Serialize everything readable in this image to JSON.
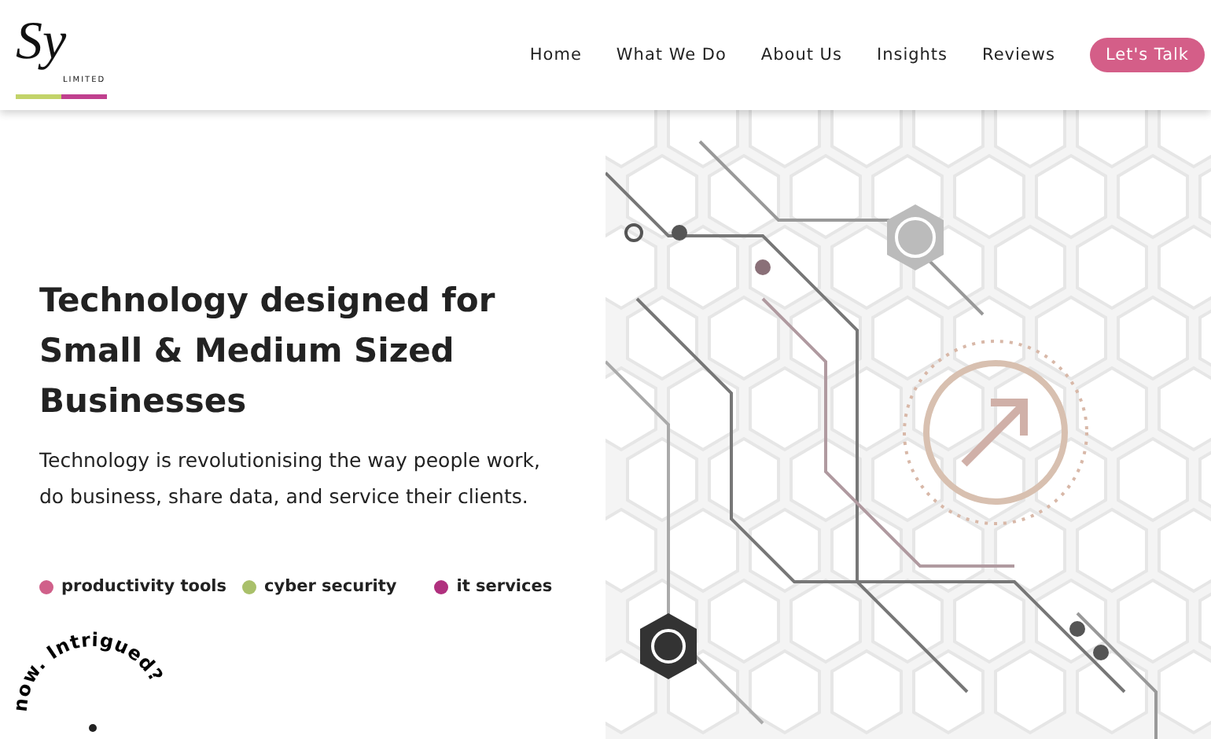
{
  "logo": {
    "monogram": "Sy",
    "subtitle": "LIMITED"
  },
  "nav": {
    "items": [
      {
        "label": "Home"
      },
      {
        "label": "What We Do"
      },
      {
        "label": "About Us"
      },
      {
        "label": "Insights"
      },
      {
        "label": "Reviews"
      }
    ],
    "cta": "Let's Talk"
  },
  "hero": {
    "heading": "Technology designed for Small & Medium Sized Businesses",
    "text": "Technology is revolutionising the way people work, do business, share data, and service their clients.",
    "tags": [
      {
        "label": "productivity tools",
        "color": "#d0608a"
      },
      {
        "label": "cyber security",
        "color": "#a9c06a"
      },
      {
        "label": "it services",
        "color": "#b0307e"
      }
    ],
    "badge_text": "now. Intrigued?"
  }
}
